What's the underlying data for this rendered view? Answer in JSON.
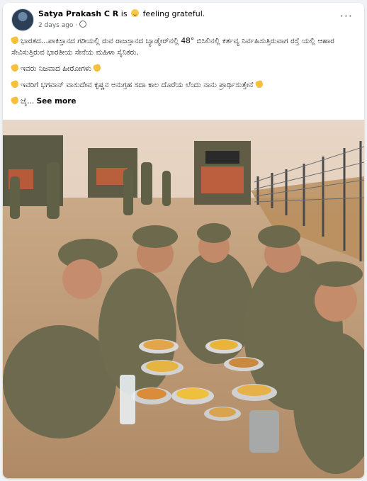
{
  "post": {
    "author": "Satya Prakash C R",
    "is_text": "is",
    "feeling": "feeling grateful.",
    "time": "2 days ago ·",
    "more_label": "···",
    "paragraphs": [
      "ಭಾರತದ...ಪಾಕಿಸ್ತಾನದ ಗಡಿಯಲ್ಲಿ ರುವ ರಾಜಸ್ತಾನದ ಬ್ಯಾಡ್ಮೇರ್‌ನಲ್ಲಿ 48° ಬಿಸಿಲಿನಲ್ಲಿ ಕರ್ತವ್ಯ ನಿರ್ವಹಿಸುತ್ತಿರುವಾಗ ರಸ್ತೆ ಯಲ್ಲಿ ಆಹಾರ ಸೇವಿಸುತ್ತಿರುವ ಭಾರತೀಯ ಸೇನೆಯ ಮಹಿಳಾ ಸೈನಿಕರು.",
      "ಇವರು ನಿಜವಾದ ಹೀರೋಗಳು",
      "ಇವರಿಗೆ ಭಗವಾನ್ ವಾಸುದೇವ ಕೃಷ್ಣನ ಅನುಗ್ರಹ ಸದಾ ಕಾಲ ದೊರೆಯ ಲೆಂದು ನಾನು ಪ್ರಾರ್ಥಿಸುತ್ತೇನೆ"
    ],
    "last_line_prefix": "ಜೈ...",
    "see_more": "See more"
  }
}
